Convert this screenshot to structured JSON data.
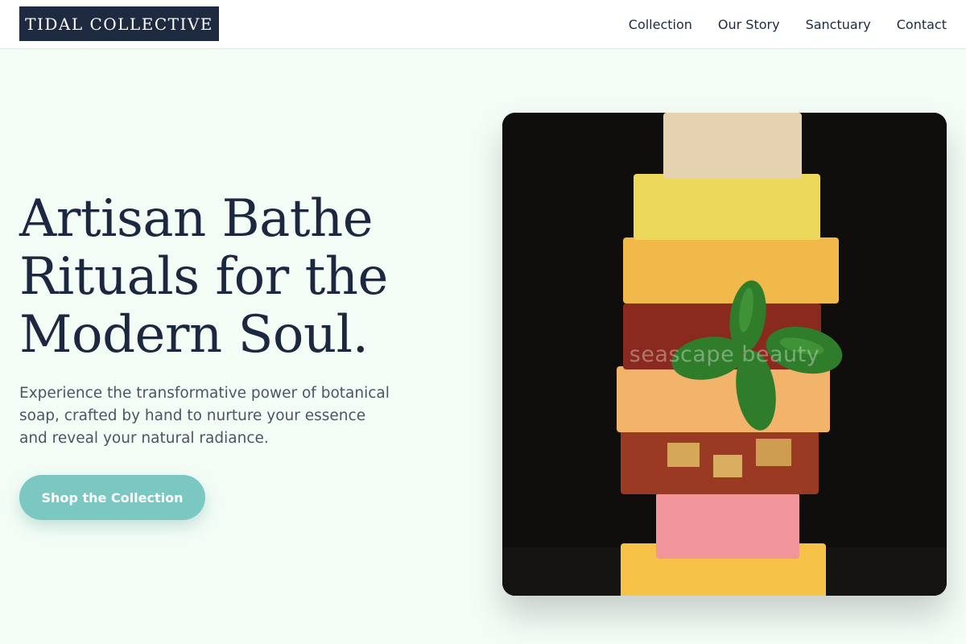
{
  "header": {
    "logo": "TIDAL COLLECTIVE",
    "nav": [
      {
        "label": "Collection"
      },
      {
        "label": "Our Story"
      },
      {
        "label": "Sanctuary"
      },
      {
        "label": "Contact"
      }
    ]
  },
  "hero": {
    "title_lines": [
      "Artisan Bathe",
      "Rituals for the",
      "Modern Soul."
    ],
    "subtitle": "Experience the transformative power of botanical soap, crafted by hand to nurture your essence and reveal your natural radiance.",
    "cta_label": "Shop the Collection",
    "image": {
      "watermark": "seascape beauty",
      "background_color": "#0f0e0c",
      "soap_colors": [
        "#e4d2b0",
        "#ecd85a",
        "#f1b84a",
        "#8a2a1e",
        "#f2b36a",
        "#9b3a22",
        "#f2959a",
        "#f6c247"
      ],
      "leaf_color": "#2f7d2a"
    }
  },
  "colors": {
    "background": "#f3fdf6",
    "accent": "#7ac8c1",
    "navy": "#1e2a40"
  }
}
